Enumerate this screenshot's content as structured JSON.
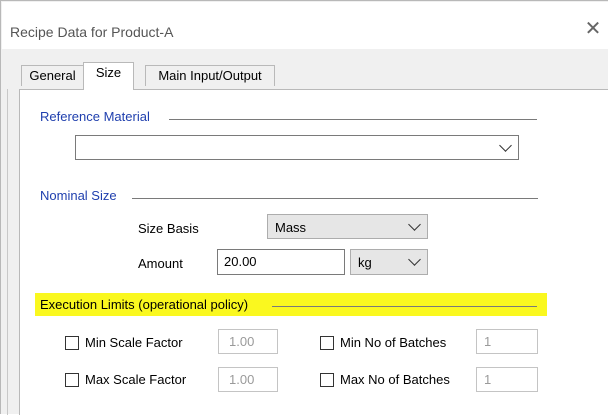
{
  "window": {
    "title": "Recipe Data for Product-A",
    "close_icon": "close-icon"
  },
  "tabs": [
    {
      "label": "General",
      "active": false
    },
    {
      "label": "Size",
      "active": true
    },
    {
      "label": "Main Input/Output",
      "active": false
    }
  ],
  "reference_material": {
    "label": "Reference Material",
    "value": ""
  },
  "nominal_size": {
    "label": "Nominal Size",
    "size_basis_label": "Size Basis",
    "size_basis_value": "Mass",
    "amount_label": "Amount",
    "amount_value": "20.00",
    "unit_value": "kg"
  },
  "execution_limits": {
    "label": "Execution Limits (operational policy)",
    "highlight_color": "#faf81f",
    "min_scale_label": "Min Scale Factor",
    "min_scale_value": "1.00",
    "max_scale_label": "Max Scale Factor",
    "max_scale_value": "1.00",
    "min_batches_label": "Min No of Batches",
    "min_batches_value": "1",
    "max_batches_label": "Max No of Batches",
    "max_batches_value": "1"
  }
}
